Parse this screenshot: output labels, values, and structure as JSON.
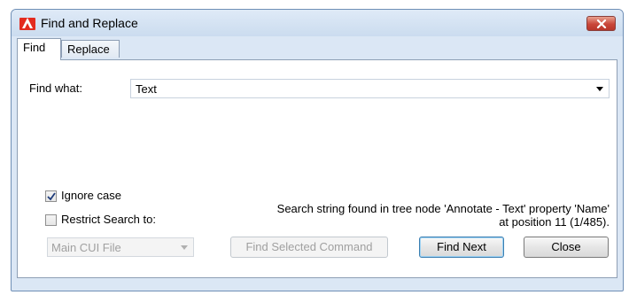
{
  "window": {
    "title": "Find and Replace"
  },
  "tabs": [
    {
      "label": "Find",
      "active": true
    },
    {
      "label": "Replace",
      "active": false
    }
  ],
  "find": {
    "label": "Find what:",
    "value": "Text"
  },
  "options": {
    "ignore_case": {
      "label": "Ignore case",
      "checked": true
    },
    "restrict_search": {
      "label": "Restrict Search to:",
      "checked": false
    },
    "restrict_select": {
      "value": "Main CUI File",
      "enabled": false
    }
  },
  "status": {
    "line1": "Search string found in tree node 'Annotate - Text' property 'Name'",
    "line2": "at position 11 (1/485)."
  },
  "buttons": {
    "find_selected": {
      "label": "Find Selected Command",
      "enabled": false
    },
    "find_next": {
      "label": "Find Next"
    },
    "close": {
      "label": "Close"
    }
  },
  "colors": {
    "window_bg": "#dbe7f5",
    "close_red": "#c9473a",
    "default_button_border": "#3c7fb1"
  }
}
